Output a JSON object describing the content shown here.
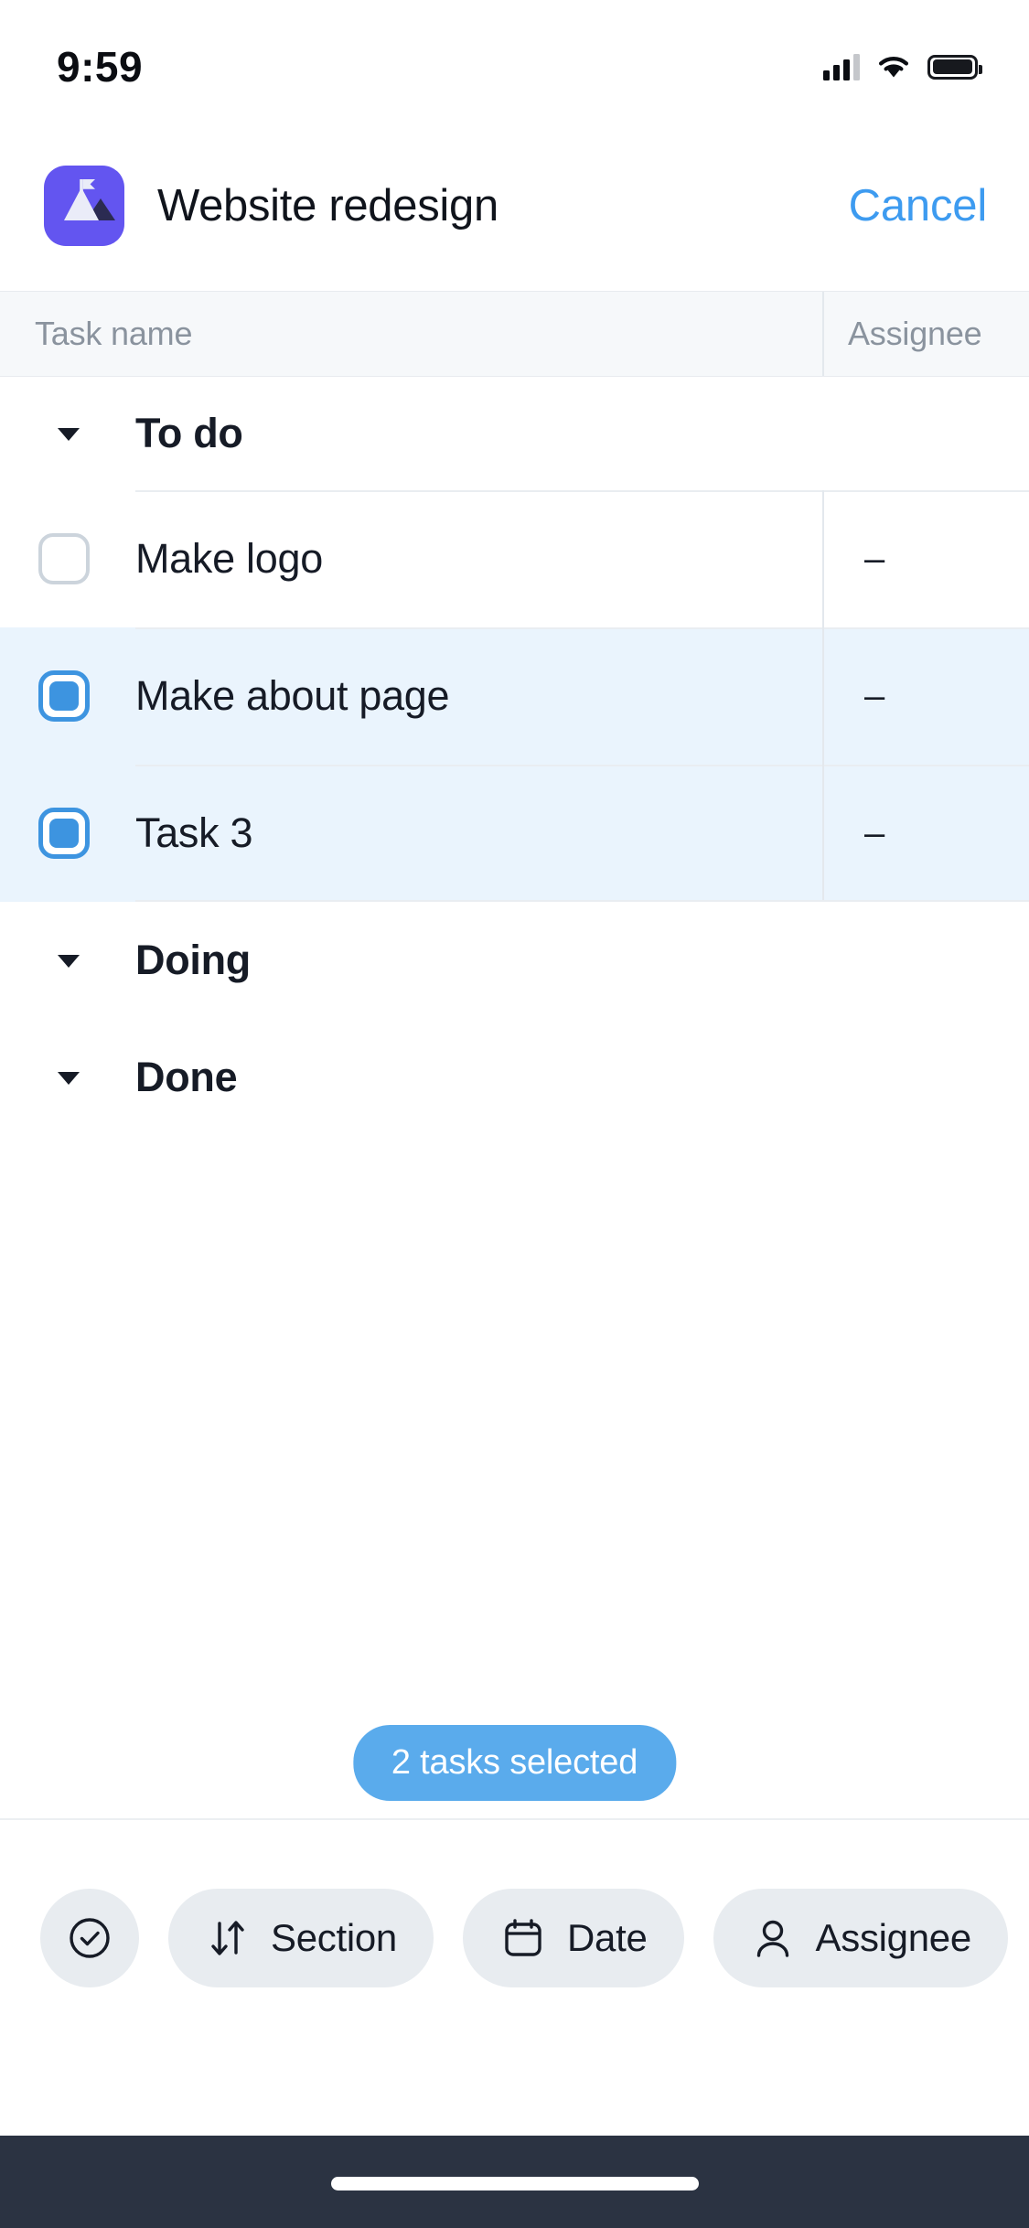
{
  "status_bar": {
    "time": "9:59",
    "signal_icon": "cellular-signal-icon",
    "wifi_icon": "wifi-icon",
    "battery_icon": "battery-icon"
  },
  "nav": {
    "app_icon": "mountain-flag-project-icon",
    "title": "Website redesign",
    "cancel_label": "Cancel"
  },
  "table": {
    "columns": [
      {
        "key": "task_name",
        "label": "Task name"
      },
      {
        "key": "assignee",
        "label": "Assignee"
      }
    ],
    "sections": [
      {
        "name": "To do",
        "collapse_icon": "caret-down-icon",
        "expanded": true,
        "tasks": [
          {
            "name": "Make logo",
            "assignee": "–",
            "selected": false,
            "checkbox_icon": "checkbox-unchecked-icon"
          },
          {
            "name": "Make about page",
            "assignee": "–",
            "selected": true,
            "checkbox_icon": "checkbox-selected-icon"
          },
          {
            "name": "Task 3",
            "assignee": "–",
            "selected": true,
            "checkbox_icon": "checkbox-selected-icon"
          }
        ]
      },
      {
        "name": "Doing",
        "collapse_icon": "caret-down-icon",
        "expanded": true,
        "tasks": []
      },
      {
        "name": "Done",
        "collapse_icon": "caret-down-icon",
        "expanded": true,
        "tasks": []
      }
    ]
  },
  "selection": {
    "pill_label": "2 tasks selected",
    "count": 2
  },
  "action_bar": {
    "chips": [
      {
        "icon": "check-circle-icon",
        "label": ""
      },
      {
        "icon": "sort-arrows-icon",
        "label": "Section"
      },
      {
        "icon": "calendar-icon",
        "label": "Date"
      },
      {
        "icon": "person-icon",
        "label": "Assignee"
      },
      {
        "icon": "add-to-project-icon",
        "label": ""
      }
    ]
  },
  "home_indicator": "home-indicator-bar",
  "colors": {
    "accent_blue": "#3d9bf0",
    "selection_blue": "#5aabec",
    "selected_row_bg": "#eaf4fd",
    "app_icon_purple": "#6355f0",
    "header_bg": "#f6f8fa",
    "text_primary": "#161b26",
    "text_muted": "#8a939e",
    "home_bar_bg": "#2b3342"
  }
}
